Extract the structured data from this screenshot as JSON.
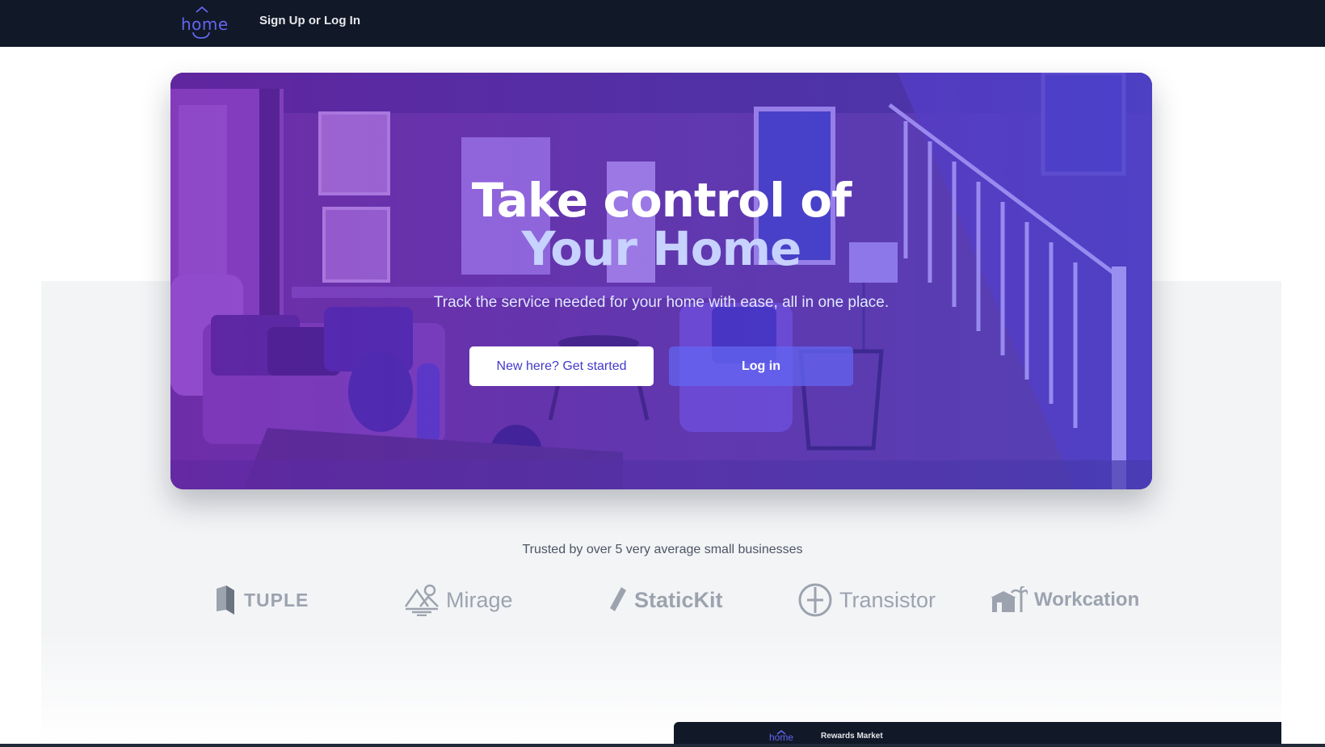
{
  "nav": {
    "logo_text": "home",
    "signup_link": "Sign Up or Log In"
  },
  "hero": {
    "title_line1": "Take control of",
    "title_line2": "Your Home",
    "subtitle": "Track the service needed for your home with ease, all in one place.",
    "primary_button": "New here? Get started",
    "secondary_button": "Log in"
  },
  "trusted": {
    "text": "Trusted by over 5 very average small businesses",
    "brands": [
      {
        "name": "TUPLE",
        "icon": "tuple-logo-icon"
      },
      {
        "name": "Mirage",
        "icon": "mirage-logo-icon"
      },
      {
        "name": "StaticKit",
        "icon": "statickit-logo-icon"
      },
      {
        "name": "Transistor",
        "icon": "transistor-logo-icon"
      },
      {
        "name": "Workcation",
        "icon": "workcation-logo-icon"
      }
    ]
  },
  "preview": {
    "logo_text": "home",
    "link": "Rewards Market"
  },
  "colors": {
    "nav_bg": "#111827",
    "accent": "#6366f1",
    "hero_tint_start": "#7e22ce",
    "hero_tint_end": "#4f46e5",
    "button_text": "#4338ca",
    "section_bg": "#f3f4f6",
    "brand_gray": "#9ca3af"
  }
}
